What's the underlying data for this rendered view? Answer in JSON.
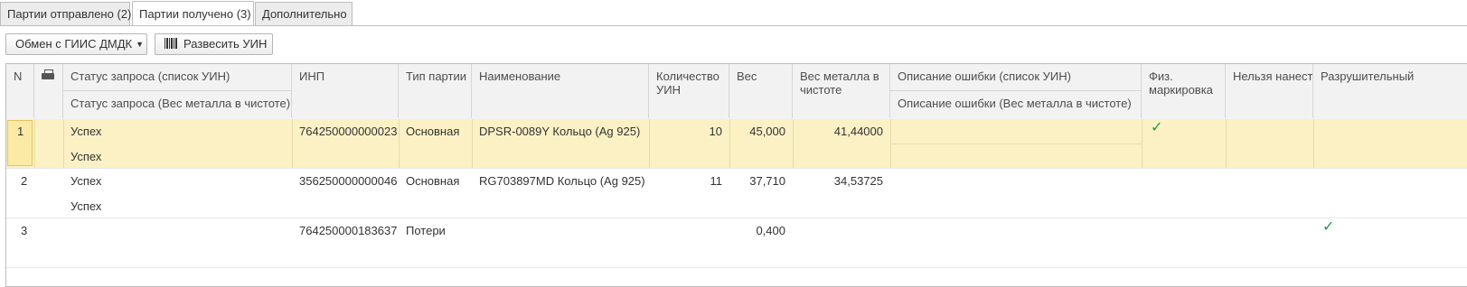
{
  "tabs": [
    {
      "label": "Партии отправлено (2)",
      "active": false
    },
    {
      "label": "Партии получено (3)",
      "active": true
    },
    {
      "label": "Дополнительно",
      "active": false
    }
  ],
  "toolbar": {
    "exchange_label": "Обмен с ГИИС ДМДК",
    "split_uin_label": "Развесить УИН"
  },
  "table": {
    "headers": {
      "n": "N",
      "status_uin": "Статус запроса (список УИН)",
      "status_metal": "Статус запроса (Вес металла в чистоте)",
      "inp": "ИНП",
      "type": "Тип партии",
      "name": "Наименование",
      "qty": "Количество УИН",
      "weight": "Вес",
      "metal_weight": "Вес металла в чистоте",
      "error_uin": "Описание ошибки (список УИН)",
      "error_metal": "Описание ошибки (Вес металла в чистоте)",
      "phys_marking": "Физ. маркировка",
      "cannot_apply": "Нельзя нанести физ…",
      "destructive": "Разрушительный"
    },
    "rows": [
      {
        "n": "1",
        "status_uin": "Успех",
        "status_metal": "Успех",
        "inp": "764250000000023",
        "type": "Основная",
        "name": "DPSR-0089Y Кольцо (Ag 925)",
        "qty": "10",
        "weight": "45,000",
        "metal_weight": "41,44000",
        "phys_marking": true,
        "destructive": false
      },
      {
        "n": "2",
        "status_uin": "Успех",
        "status_metal": "Успех",
        "inp": "356250000000046",
        "type": "Основная",
        "name": "RG703897MD Кольцо (Ag 925)",
        "qty": "11",
        "weight": "37,710",
        "metal_weight": "34,53725",
        "phys_marking": false,
        "destructive": false
      },
      {
        "n": "3",
        "status_uin": "",
        "status_metal": "",
        "inp": "764250000183637",
        "type": "Потери",
        "name": "",
        "qty": "",
        "weight": "0,400",
        "metal_weight": "",
        "phys_marking": false,
        "destructive": true
      }
    ]
  },
  "colors": {
    "selected_row": "#fbf1c5",
    "check": "#1a9a4a"
  }
}
